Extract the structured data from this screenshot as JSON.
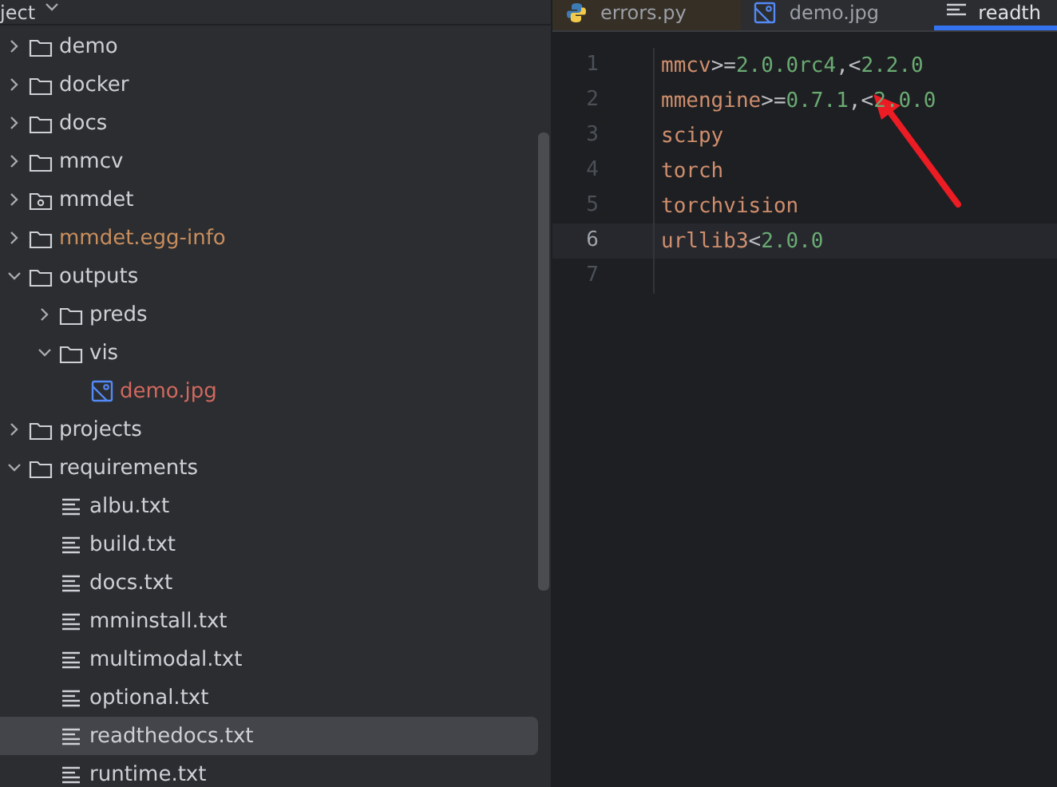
{
  "project_panel": {
    "title": "ject",
    "tree": [
      {
        "name": "demo",
        "kind": "folder",
        "expanded": false,
        "selected": false
      },
      {
        "name": "docker",
        "kind": "folder",
        "expanded": false,
        "selected": false
      },
      {
        "name": "docs",
        "kind": "folder",
        "expanded": false,
        "selected": false
      },
      {
        "name": "mmcv",
        "kind": "folder",
        "expanded": false,
        "selected": false
      },
      {
        "name": "mmdet",
        "kind": "module",
        "expanded": false,
        "selected": false
      },
      {
        "name": "mmdet.egg-info",
        "kind": "folder",
        "expanded": false,
        "selected": false,
        "color": "#c98e5e"
      },
      {
        "name": "outputs",
        "kind": "folder",
        "expanded": true,
        "selected": false,
        "children": [
          {
            "name": "preds",
            "kind": "folder",
            "expanded": false,
            "selected": false
          },
          {
            "name": "vis",
            "kind": "folder",
            "expanded": true,
            "selected": false,
            "children": [
              {
                "name": "demo.jpg",
                "kind": "image",
                "selected": false,
                "color": "#d1695f"
              }
            ]
          }
        ]
      },
      {
        "name": "projects",
        "kind": "folder",
        "expanded": false,
        "selected": false
      },
      {
        "name": "requirements",
        "kind": "folder",
        "expanded": true,
        "selected": false,
        "children": [
          {
            "name": "albu.txt",
            "kind": "text",
            "selected": false
          },
          {
            "name": "build.txt",
            "kind": "text",
            "selected": false
          },
          {
            "name": "docs.txt",
            "kind": "text",
            "selected": false
          },
          {
            "name": "mminstall.txt",
            "kind": "text",
            "selected": false
          },
          {
            "name": "multimodal.txt",
            "kind": "text",
            "selected": false
          },
          {
            "name": "optional.txt",
            "kind": "text",
            "selected": false
          },
          {
            "name": "readthedocs.txt",
            "kind": "text",
            "selected": true
          },
          {
            "name": "runtime.txt",
            "kind": "text",
            "selected": false
          }
        ]
      }
    ]
  },
  "editor": {
    "tabs": [
      {
        "label": "errors.py",
        "kind": "python",
        "selected": false
      },
      {
        "label": "demo.jpg",
        "kind": "image",
        "selected": false
      },
      {
        "label": "readth",
        "kind": "text",
        "selected": true
      }
    ],
    "lines": [
      {
        "number": "1",
        "current": false,
        "tokens": [
          {
            "text": "mmcv",
            "kind": "name"
          },
          {
            "text": ">=",
            "kind": "op"
          },
          {
            "text": "2.0.0rc4",
            "kind": "version"
          },
          {
            "text": ",<",
            "kind": "op"
          },
          {
            "text": "2.2.0",
            "kind": "version"
          }
        ]
      },
      {
        "number": "2",
        "current": false,
        "tokens": [
          {
            "text": "mmengine",
            "kind": "name"
          },
          {
            "text": ">=",
            "kind": "op"
          },
          {
            "text": "0.7.1",
            "kind": "version"
          },
          {
            "text": ",<",
            "kind": "op"
          },
          {
            "text": "2.0.0",
            "kind": "version"
          }
        ]
      },
      {
        "number": "3",
        "current": false,
        "tokens": [
          {
            "text": "scipy",
            "kind": "name"
          }
        ]
      },
      {
        "number": "4",
        "current": false,
        "tokens": [
          {
            "text": "torch",
            "kind": "name"
          }
        ]
      },
      {
        "number": "5",
        "current": false,
        "tokens": [
          {
            "text": "torchvision",
            "kind": "name"
          }
        ]
      },
      {
        "number": "6",
        "current": true,
        "tokens": [
          {
            "text": "urllib3",
            "kind": "name"
          },
          {
            "text": "<",
            "kind": "op"
          },
          {
            "text": "2.0.0",
            "kind": "version"
          }
        ]
      },
      {
        "number": "7",
        "current": false
      }
    ]
  }
}
